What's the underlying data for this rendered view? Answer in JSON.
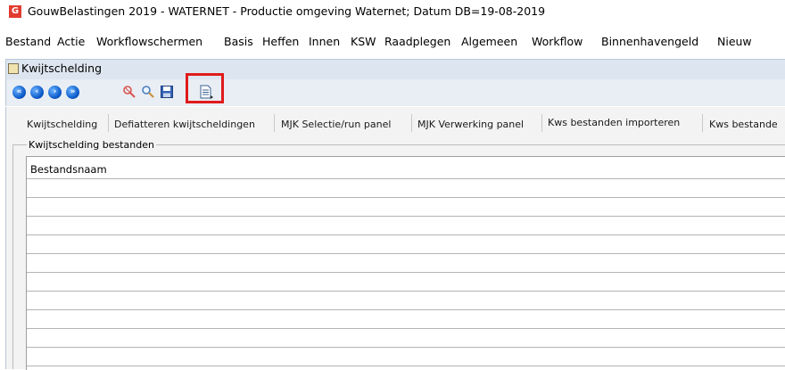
{
  "window": {
    "app_icon_letter": "G",
    "title": "GouwBelastingen 2019 - WATERNET - Productie omgeving Waternet; Datum DB=19-08-2019"
  },
  "menu": {
    "items": [
      "Bestand",
      "Actie",
      "Workflowschermen",
      "Basis",
      "Heffen",
      "Innen",
      "KSW",
      "Raadplegen",
      "Algemeen",
      "Workflow",
      "Binnenhavengeld",
      "Nieuw"
    ]
  },
  "subwindow": {
    "title": "Kwijtschelding"
  },
  "toolbar": {
    "buttons": [
      "first-icon",
      "previous-icon",
      "next-icon",
      "last-icon",
      "search-clear-icon",
      "search-icon",
      "save-icon",
      "document-export-icon"
    ],
    "highlighted": "document-export-icon",
    "highlight_color": "#e01b1b"
  },
  "tabs": {
    "items": [
      "Kwijtschelding",
      "Defiatteren kwijtscheldingen",
      "MJK Selectie/run panel",
      "MJK Verwerking panel",
      "Kws bestanden importeren",
      "Kws bestande"
    ],
    "active_index": 4
  },
  "group": {
    "label": "Kwijtschelding bestanden",
    "column_header": "Bestandsnaam",
    "rows": []
  }
}
